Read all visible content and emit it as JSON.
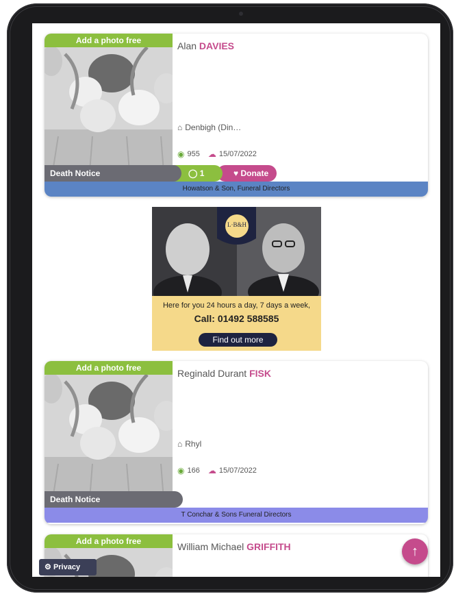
{
  "cards": [
    {
      "add_photo": "Add a photo free",
      "first_names": "Alan",
      "surname": "DAVIES",
      "location": "Denbigh (Din…",
      "views": "955",
      "date": "15/07/2022",
      "notice_type": "Death Notice",
      "comments": "1",
      "donate_label": "Donate",
      "director": "Howatson & Son, Funeral Directors",
      "director_color": "#5b84c4"
    },
    {
      "add_photo": "Add a photo free",
      "first_names": "Reginald Durant",
      "surname": "FISK",
      "location": "Rhyl",
      "views": "166",
      "date": "15/07/2022",
      "notice_type": "Death Notice",
      "director": "T Conchar & Sons Funeral Directors",
      "director_color": "#8b8be8"
    },
    {
      "add_photo": "Add a photo free",
      "first_names": "William Michael",
      "surname": "GRIFFITH"
    }
  ],
  "ad": {
    "logo_text": "L·B&H",
    "tagline": "Here for you 24 hours a day, 7 days a week,",
    "phone": "Call: 01492 588585",
    "button": "Find out more"
  },
  "privacy_label": "Privacy",
  "icons": {
    "home": "home-icon",
    "eye": "eye-icon",
    "cloud": "cloud-upload-icon",
    "comment": "comment-icon",
    "heart": "heart-icon",
    "gear": "gear-icon",
    "arrow": "arrow-up-icon"
  },
  "colors": {
    "accent_pink": "#c54b8c",
    "accent_green": "#8cbf3f",
    "notice_grey": "#6b6b73"
  }
}
